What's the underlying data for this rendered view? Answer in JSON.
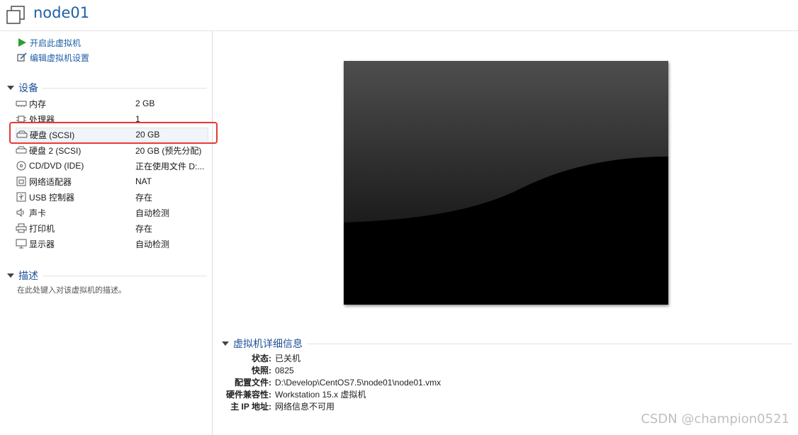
{
  "window": {
    "title": "node01"
  },
  "actions": [
    {
      "label": "开启此虚拟机",
      "icon": "play-icon"
    },
    {
      "label": "编辑虚拟机设置",
      "icon": "edit-settings-icon"
    }
  ],
  "devices_section": {
    "title": "设备",
    "items": [
      {
        "name": "内存",
        "value": "2 GB",
        "icon": "memory-icon"
      },
      {
        "name": "处理器",
        "value": "1",
        "icon": "cpu-icon"
      },
      {
        "name": "硬盘 (SCSI)",
        "value": "20 GB",
        "icon": "harddisk-icon"
      },
      {
        "name": "硬盘 2 (SCSI)",
        "value": "20 GB (预先分配)",
        "icon": "harddisk-icon"
      },
      {
        "name": "CD/DVD (IDE)",
        "value": "正在使用文件 D:...",
        "icon": "cdrom-icon"
      },
      {
        "name": "网络适配器",
        "value": "NAT",
        "icon": "network-icon"
      },
      {
        "name": "USB 控制器",
        "value": "存在",
        "icon": "usb-icon"
      },
      {
        "name": "声卡",
        "value": "自动检测",
        "icon": "speaker-icon"
      },
      {
        "name": "打印机",
        "value": "存在",
        "icon": "printer-icon"
      },
      {
        "name": "显示器",
        "value": "自动检测",
        "icon": "monitor-icon"
      }
    ]
  },
  "description_section": {
    "title": "描述",
    "placeholder": "在此处键入对该虚拟机的描述。"
  },
  "details_section": {
    "title": "虚拟机详细信息",
    "rows": [
      {
        "key": "状态:",
        "value": "已关机"
      },
      {
        "key": "快照:",
        "value": "0825"
      },
      {
        "key": "配置文件:",
        "value": "D:\\Develop\\CentOS7.5\\node01\\node01.vmx"
      },
      {
        "key": "硬件兼容性:",
        "value": "Workstation 15.x 虚拟机"
      },
      {
        "key": "主 IP 地址:",
        "value": "网络信息不可用"
      }
    ]
  },
  "watermark": "CSDN @champion0521",
  "colors": {
    "link": "#1e5fa8",
    "section": "#1e4f9a",
    "highlight": "#e53935"
  }
}
